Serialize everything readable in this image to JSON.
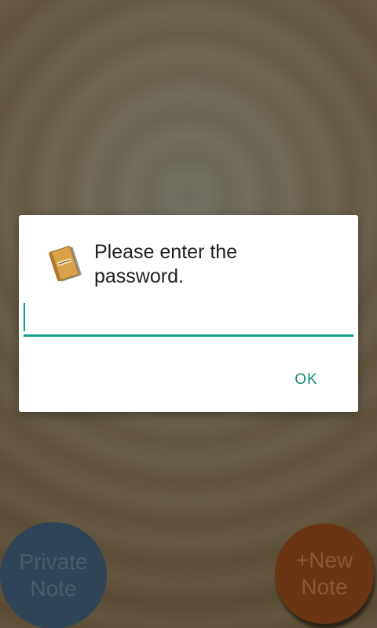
{
  "dialog": {
    "title": "Please enter the password.",
    "input_value": "",
    "ok_label": "OK",
    "icon": "notebook-icon",
    "accent_color": "#199e8c"
  },
  "buttons": {
    "private_note_label": "Private\nNote",
    "new_note_label": "+New\nNote",
    "private_note_color": "#2f4456",
    "new_note_color": "#6b3513"
  }
}
